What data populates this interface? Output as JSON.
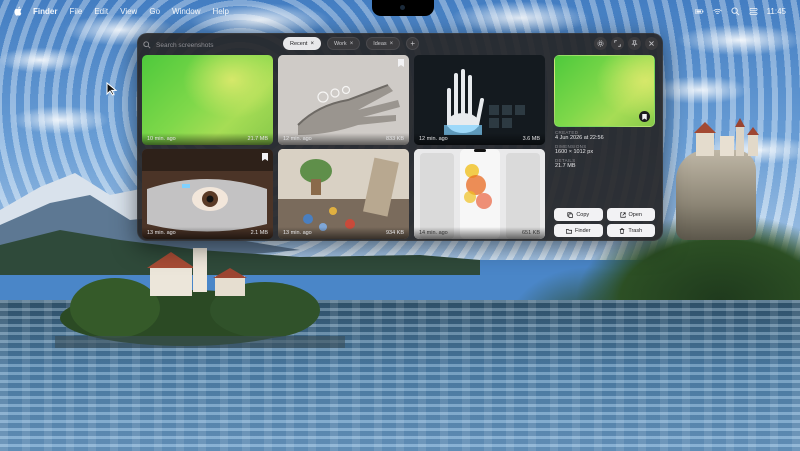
{
  "menubar": {
    "app_name": "Finder",
    "items": [
      "File",
      "Edit",
      "View",
      "Go",
      "Window",
      "Help"
    ],
    "clock": "11:45"
  },
  "panel": {
    "search": {
      "placeholder": "Search screenshots",
      "value": ""
    },
    "filters": [
      {
        "label": "Recent",
        "active": true
      },
      {
        "label": "Work",
        "active": false
      },
      {
        "label": "Ideas",
        "active": false
      }
    ],
    "add_filter_label": "+",
    "grid": [
      {
        "time": "10 min. ago",
        "size": "21.7 MB",
        "thumb": "green-gradient",
        "bookmarked": false
      },
      {
        "time": "12 min. ago",
        "size": "833 KB",
        "thumb": "robot-hand",
        "bookmarked": true
      },
      {
        "time": "12 min. ago",
        "size": "3.6 MB",
        "thumb": "holographic-hand",
        "bookmarked": false
      },
      {
        "time": "13 min. ago",
        "size": "2.1 MB",
        "thumb": "vr-headset-eye",
        "bookmarked": true
      },
      {
        "time": "13 min. ago",
        "size": "934 KB",
        "thumb": "messy-room",
        "bookmarked": false
      },
      {
        "time": "14 min. ago",
        "size": "651 KB",
        "thumb": "phone-heatmaps",
        "bookmarked": false
      }
    ],
    "details": {
      "created_label": "Created",
      "created_value": "4 Jun 2026 at 22:56",
      "dimensions_label": "Dimensions",
      "dimensions_value": "1600 × 1012 px",
      "details_label": "Details",
      "details_value": "21.7 MB"
    },
    "actions": {
      "copy": "Copy",
      "open": "Open",
      "finder": "Finder",
      "trash": "Trash"
    }
  },
  "colors": {
    "panel_bg": "#262628",
    "pill_active": "#e8e8ea",
    "button_bg": "#f2f2f4"
  }
}
